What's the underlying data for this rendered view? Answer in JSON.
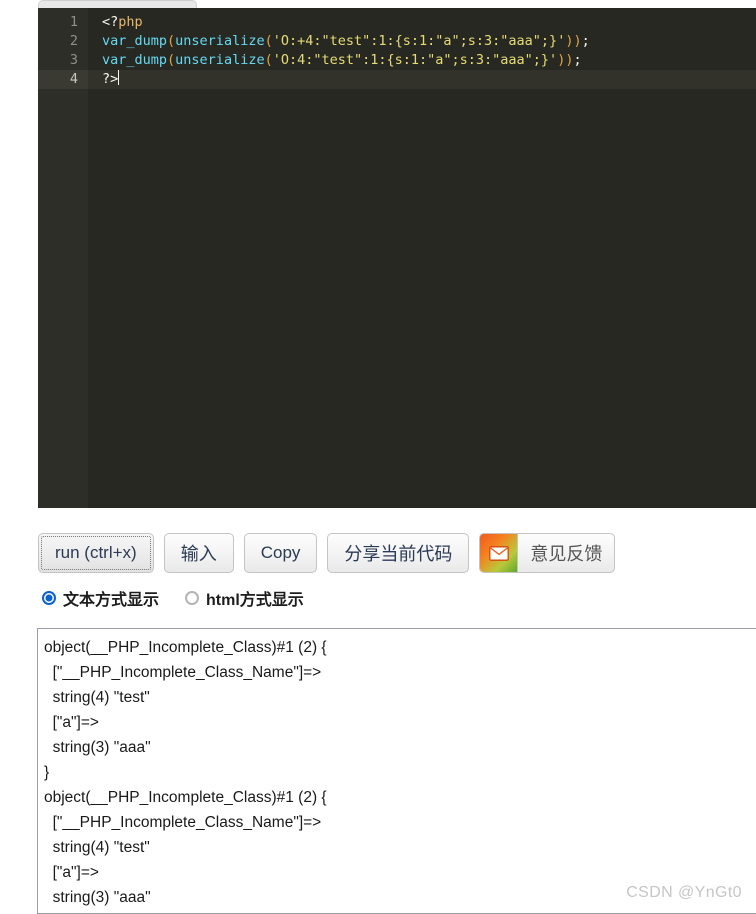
{
  "editor": {
    "tab_label": "",
    "language": "php",
    "line_numbers": [
      "1",
      "2",
      "3",
      "4"
    ],
    "active_line": 4,
    "lines": [
      {
        "number": "1",
        "text": "<?php",
        "tokens": [
          {
            "t": "<?",
            "c": "tok-plain"
          },
          {
            "t": "php",
            "c": "tok-tag"
          }
        ]
      },
      {
        "number": "2",
        "text": "var_dump(unserialize('O:+4:\"test\":1:{s:1:\"a\";s:3:\"aaa\";}'));",
        "tokens": [
          {
            "t": "var_dump",
            "c": "tok-fn"
          },
          {
            "t": "(",
            "c": "tok-paren"
          },
          {
            "t": "unserialize",
            "c": "tok-fn"
          },
          {
            "t": "(",
            "c": "tok-paren"
          },
          {
            "t": "'O:+4:\"test\":1:{s:1:\"a\";s:3:\"aaa\";}'",
            "c": "tok-str"
          },
          {
            "t": "))",
            "c": "tok-paren"
          },
          {
            "t": ";",
            "c": "tok-plain"
          }
        ]
      },
      {
        "number": "3",
        "text": "var_dump(unserialize('O:4:\"test\":1:{s:1:\"a\";s:3:\"aaa\";}'));",
        "tokens": [
          {
            "t": "var_dump",
            "c": "tok-fn"
          },
          {
            "t": "(",
            "c": "tok-paren"
          },
          {
            "t": "unserialize",
            "c": "tok-fn"
          },
          {
            "t": "(",
            "c": "tok-paren"
          },
          {
            "t": "'O:4:\"test\":1:{s:1:\"a\";s:3:\"aaa\";}'",
            "c": "tok-str"
          },
          {
            "t": "))",
            "c": "tok-paren"
          },
          {
            "t": ";",
            "c": "tok-plain"
          }
        ]
      },
      {
        "number": "4",
        "text": "?>",
        "tokens": [
          {
            "t": "?>",
            "c": "tok-plain"
          }
        ]
      }
    ]
  },
  "toolbar": {
    "run_label": "run (ctrl+x)",
    "input_label": "输入",
    "copy_label": "Copy",
    "share_label": "分享当前代码",
    "feedback_label": "意见反馈",
    "feedback_icon": "envelope-icon"
  },
  "display_mode": {
    "options": [
      {
        "label": "文本方式显示",
        "checked": true
      },
      {
        "label": "html方式显示",
        "checked": false
      }
    ]
  },
  "output": {
    "lines": [
      "object(__PHP_Incomplete_Class)#1 (2) {",
      "  [\"__PHP_Incomplete_Class_Name\"]=>",
      "  string(4) \"test\"",
      "  [\"a\"]=>",
      "  string(3) \"aaa\"",
      "}",
      "object(__PHP_Incomplete_Class)#1 (2) {",
      "  [\"__PHP_Incomplete_Class_Name\"]=>",
      "  string(4) \"test\"",
      "  [\"a\"]=>",
      "  string(3) \"aaa\""
    ]
  },
  "watermark": {
    "text": "CSDN @YnGt0"
  },
  "colors": {
    "editor_bg": "#272822",
    "gutter_bg": "#2e2e28",
    "accent_radio": "#0a62d0",
    "string": "#e6db74",
    "function": "#66d9ef",
    "paren": "#e0a44a"
  }
}
